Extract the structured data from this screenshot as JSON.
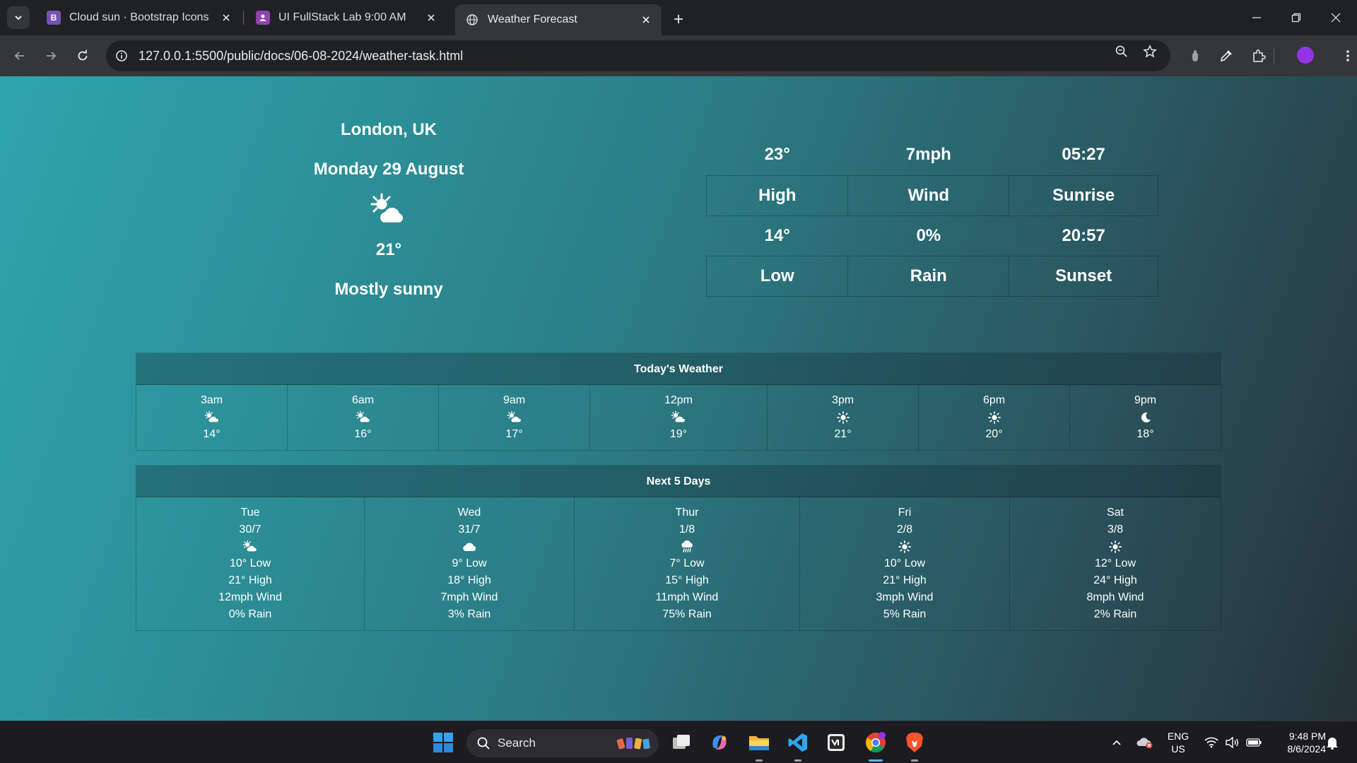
{
  "browser": {
    "tabs": [
      {
        "title": "Cloud sun · Bootstrap Icons",
        "favicon": "bootstrap-icon",
        "favicon_color": "#7952b3",
        "favicon_text": "B"
      },
      {
        "title": "UI FullStack Lab 9:00 AM",
        "favicon": "classroom-icon",
        "favicon_color": "#8e44ad"
      },
      {
        "title": "Weather Forecast",
        "favicon": "globe-icon",
        "active": true
      }
    ],
    "url": "127.0.0.1:5500/public/docs/06-08-2024/weather-task.html",
    "profile_color": "#9334e6"
  },
  "current": {
    "city": "London, UK",
    "date": "Monday 29 August",
    "icon": "cloud-sun-icon",
    "temp": "21°",
    "summary": "Mostly sunny"
  },
  "stats": {
    "high_value": "23°",
    "high_label": "High",
    "wind_value": "7mph",
    "wind_label": "Wind",
    "sunrise_value": "05:27",
    "sunrise_label": "Sunrise",
    "low_value": "14°",
    "low_label": "Low",
    "rain_value": "0%",
    "rain_label": "Rain",
    "sunset_value": "20:57",
    "sunset_label": "Sunset"
  },
  "hourly": {
    "title": "Today's Weather",
    "items": [
      {
        "time": "3am",
        "icon": "cloud-sun-icon",
        "temp": "14°"
      },
      {
        "time": "6am",
        "icon": "cloud-sun-icon",
        "temp": "16°"
      },
      {
        "time": "9am",
        "icon": "cloud-sun-icon",
        "temp": "17°"
      },
      {
        "time": "12pm",
        "icon": "cloud-sun-icon",
        "temp": "19°"
      },
      {
        "time": "3pm",
        "icon": "sun-icon",
        "temp": "21°"
      },
      {
        "time": "6pm",
        "icon": "sun-icon",
        "temp": "20°"
      },
      {
        "time": "9pm",
        "icon": "moon-icon",
        "temp": "18°"
      }
    ]
  },
  "daily": {
    "title": "Next 5 Days",
    "items": [
      {
        "day": "Tue",
        "date": "30/7",
        "icon": "cloud-sun-icon",
        "low": "10° Low",
        "high": "21° High",
        "wind": "12mph Wind",
        "rain": "0% Rain"
      },
      {
        "day": "Wed",
        "date": "31/7",
        "icon": "cloud-icon",
        "low": "9° Low",
        "high": "18° High",
        "wind": "7mph Wind",
        "rain": "3% Rain"
      },
      {
        "day": "Thur",
        "date": "1/8",
        "icon": "cloud-rain-icon",
        "low": "7° Low",
        "high": "15° High",
        "wind": "11mph Wind",
        "rain": "75% Rain"
      },
      {
        "day": "Fri",
        "date": "2/8",
        "icon": "sun-icon",
        "low": "10° Low",
        "high": "21° High",
        "wind": "3mph Wind",
        "rain": "5% Rain"
      },
      {
        "day": "Sat",
        "date": "3/8",
        "icon": "sun-icon",
        "low": "12° Low",
        "high": "24° High",
        "wind": "8mph Wind",
        "rain": "2% Rain"
      }
    ]
  },
  "taskbar": {
    "search_label": "Search",
    "lang_line1": "ENG",
    "lang_line2": "US",
    "time": "9:48 PM",
    "date": "8/6/2024"
  }
}
